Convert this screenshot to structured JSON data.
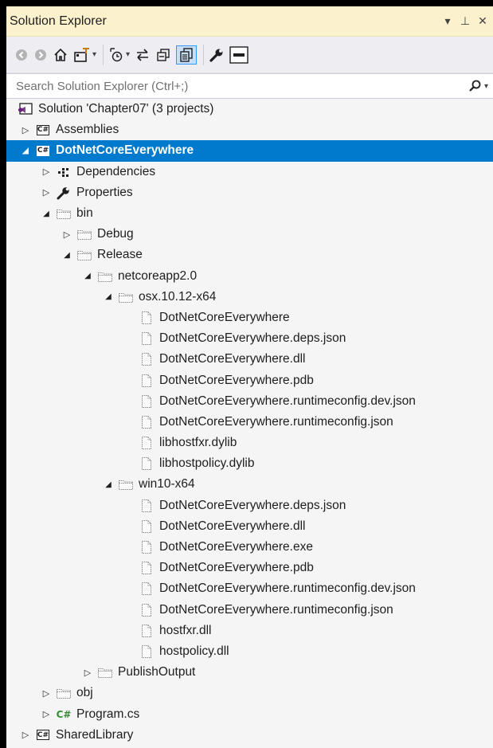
{
  "window": {
    "title": "Solution Explorer",
    "controls": [
      "▾",
      "⊥",
      "✕"
    ]
  },
  "toolbar": {
    "buttons": [
      "back",
      "forward",
      "home",
      "sync-with-active-document",
      "pending-changes-filter",
      "sync",
      "collapse-all",
      "show-all-files",
      "properties",
      "preview"
    ]
  },
  "search": {
    "placeholder": "Search Solution Explorer (Ctrl+;)",
    "value": ""
  },
  "colors": {
    "selection": "#007acc",
    "title_bar": "#fcf1cd",
    "toolbar": "#eeeef2",
    "panel": "#f5f5f5",
    "csharp_green": "#388a34",
    "vs_purple": "#68217a"
  },
  "tree": [
    {
      "label": "Solution 'Chapter07' (3 projects)",
      "icon": "solution",
      "level": 0,
      "expander": "none"
    },
    {
      "label": "Assemblies",
      "icon": "csharp-project",
      "level": 0,
      "expander": "collapsed"
    },
    {
      "label": "DotNetCoreEverywhere",
      "icon": "csharp-project",
      "level": 0,
      "expander": "expanded",
      "selected": true
    },
    {
      "label": "Dependencies",
      "icon": "dependencies",
      "level": 1,
      "expander": "collapsed"
    },
    {
      "label": "Properties",
      "icon": "wrench",
      "level": 1,
      "expander": "collapsed"
    },
    {
      "label": "bin",
      "icon": "folder-hidden",
      "level": 1,
      "expander": "expanded"
    },
    {
      "label": "Debug",
      "icon": "folder-hidden",
      "level": 2,
      "expander": "collapsed"
    },
    {
      "label": "Release",
      "icon": "folder-hidden",
      "level": 2,
      "expander": "expanded"
    },
    {
      "label": "netcoreapp2.0",
      "icon": "folder-hidden",
      "level": 3,
      "expander": "expanded"
    },
    {
      "label": "osx.10.12-x64",
      "icon": "folder-hidden",
      "level": 4,
      "expander": "expanded"
    },
    {
      "label": "DotNetCoreEverywhere",
      "icon": "file-hidden",
      "level": 5,
      "expander": "none"
    },
    {
      "label": "DotNetCoreEverywhere.deps.json",
      "icon": "file-hidden",
      "level": 5,
      "expander": "none"
    },
    {
      "label": "DotNetCoreEverywhere.dll",
      "icon": "file-hidden",
      "level": 5,
      "expander": "none"
    },
    {
      "label": "DotNetCoreEverywhere.pdb",
      "icon": "file-hidden",
      "level": 5,
      "expander": "none"
    },
    {
      "label": "DotNetCoreEverywhere.runtimeconfig.dev.json",
      "icon": "file-hidden",
      "level": 5,
      "expander": "none"
    },
    {
      "label": "DotNetCoreEverywhere.runtimeconfig.json",
      "icon": "file-hidden",
      "level": 5,
      "expander": "none"
    },
    {
      "label": "libhostfxr.dylib",
      "icon": "file-hidden",
      "level": 5,
      "expander": "none"
    },
    {
      "label": "libhostpolicy.dylib",
      "icon": "file-hidden",
      "level": 5,
      "expander": "none"
    },
    {
      "label": "win10-x64",
      "icon": "folder-hidden",
      "level": 4,
      "expander": "expanded"
    },
    {
      "label": "DotNetCoreEverywhere.deps.json",
      "icon": "file-hidden",
      "level": 5,
      "expander": "none"
    },
    {
      "label": "DotNetCoreEverywhere.dll",
      "icon": "file-hidden",
      "level": 5,
      "expander": "none"
    },
    {
      "label": "DotNetCoreEverywhere.exe",
      "icon": "file-hidden",
      "level": 5,
      "expander": "none"
    },
    {
      "label": "DotNetCoreEverywhere.pdb",
      "icon": "file-hidden",
      "level": 5,
      "expander": "none"
    },
    {
      "label": "DotNetCoreEverywhere.runtimeconfig.dev.json",
      "icon": "file-hidden",
      "level": 5,
      "expander": "none"
    },
    {
      "label": "DotNetCoreEverywhere.runtimeconfig.json",
      "icon": "file-hidden",
      "level": 5,
      "expander": "none"
    },
    {
      "label": "hostfxr.dll",
      "icon": "file-hidden",
      "level": 5,
      "expander": "none"
    },
    {
      "label": "hostpolicy.dll",
      "icon": "file-hidden",
      "level": 5,
      "expander": "none"
    },
    {
      "label": "PublishOutput",
      "icon": "folder-hidden",
      "level": 3,
      "expander": "collapsed"
    },
    {
      "label": "obj",
      "icon": "folder-hidden",
      "level": 1,
      "expander": "collapsed"
    },
    {
      "label": "Program.cs",
      "icon": "csharp-file",
      "level": 1,
      "expander": "collapsed"
    },
    {
      "label": "SharedLibrary",
      "icon": "csharp-project",
      "level": 0,
      "expander": "collapsed"
    }
  ]
}
